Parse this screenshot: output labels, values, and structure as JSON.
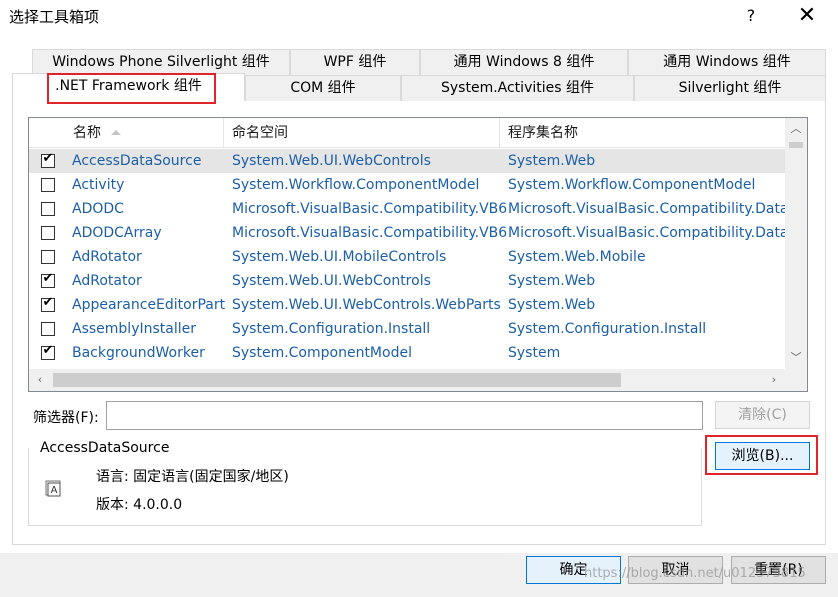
{
  "window": {
    "title": "选择工具箱项",
    "help_label": "?",
    "close_label": "✕"
  },
  "tabs": {
    "row1": [
      "Windows Phone Silverlight 组件",
      "WPF 组件",
      "通用 Windows 8 组件",
      "通用 Windows 组件"
    ],
    "row2": [
      ".NET Framework 组件",
      "COM 组件",
      "System.Activities 组件",
      "Silverlight 组件"
    ],
    "active": ".NET Framework 组件"
  },
  "grid": {
    "columns": [
      "名称",
      "命名空间",
      "程序集名称"
    ],
    "rows": [
      {
        "checked": true,
        "name": "AccessDataSource",
        "namespace": "System.Web.UI.WebControls",
        "assembly": "System.Web",
        "selected": true
      },
      {
        "checked": false,
        "name": "Activity",
        "namespace": "System.Workflow.ComponentModel",
        "assembly": "System.Workflow.ComponentModel",
        "selected": false
      },
      {
        "checked": false,
        "name": "ADODC",
        "namespace": "Microsoft.VisualBasic.Compatibility.VB6",
        "assembly": "Microsoft.VisualBasic.Compatibility.Data",
        "selected": false
      },
      {
        "checked": false,
        "name": "ADODCArray",
        "namespace": "Microsoft.VisualBasic.Compatibility.VB6",
        "assembly": "Microsoft.VisualBasic.Compatibility.Data",
        "selected": false
      },
      {
        "checked": false,
        "name": "AdRotator",
        "namespace": "System.Web.UI.MobileControls",
        "assembly": "System.Web.Mobile",
        "selected": false
      },
      {
        "checked": true,
        "name": "AdRotator",
        "namespace": "System.Web.UI.WebControls",
        "assembly": "System.Web",
        "selected": false
      },
      {
        "checked": true,
        "name": "AppearanceEditorPart",
        "namespace": "System.Web.UI.WebControls.WebParts",
        "assembly": "System.Web",
        "selected": false
      },
      {
        "checked": false,
        "name": "AssemblyInstaller",
        "namespace": "System.Configuration.Install",
        "assembly": "System.Configuration.Install",
        "selected": false
      },
      {
        "checked": true,
        "name": "BackgroundWorker",
        "namespace": "System.ComponentModel",
        "assembly": "System",
        "selected": false
      }
    ]
  },
  "filter": {
    "label": "筛选器(F):",
    "value": "",
    "clear_label": "清除(C)"
  },
  "info": {
    "title": "AccessDataSource",
    "language": "语言:  固定语言(固定国家/地区)",
    "version": "版本:  4.0.0.0",
    "browse_label": "浏览(B)..."
  },
  "footer": {
    "ok_label": "确定",
    "cancel_label": "取消",
    "reset_label": "重置(R)",
    "watermark": "https://blog.csdn.net/u012373815"
  },
  "colors": {
    "link_text": "#1c5fa8",
    "highlight_box": "#e0242a",
    "selected_row": "#e5e5e5"
  }
}
